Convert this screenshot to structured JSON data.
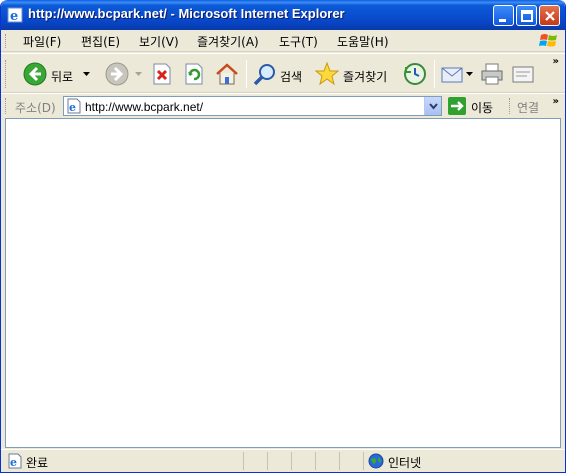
{
  "window": {
    "title": "http://www.bcpark.net/ - Microsoft Internet Explorer",
    "title_bar_color": "#0a4fd0"
  },
  "menu": {
    "items": [
      "파일(F)",
      "편집(E)",
      "보기(V)",
      "즐겨찾기(A)",
      "도구(T)",
      "도움말(H)"
    ]
  },
  "toolbar": {
    "back_label": "뒤로",
    "search_label": "검색",
    "favorites_label": "즐겨찾기",
    "overflow": "»"
  },
  "address": {
    "label": "주소(D)",
    "url": "http://www.bcpark.net/",
    "go_label": "이동",
    "links_label": "연결",
    "overflow": "»"
  },
  "status": {
    "text": "완료",
    "zone": "인터넷"
  },
  "icons": {
    "app": "ie-icon",
    "back": "back-arrow-icon",
    "forward": "forward-arrow-icon",
    "stop": "stop-icon",
    "refresh": "refresh-icon",
    "home": "home-icon",
    "search": "search-icon",
    "favorites": "star-icon",
    "history": "history-icon",
    "mail": "mail-icon",
    "print": "print-icon",
    "edit": "edit-icon"
  }
}
